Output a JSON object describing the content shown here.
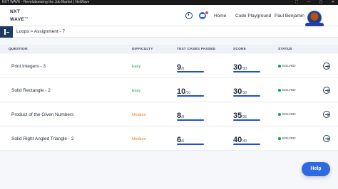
{
  "window": {
    "title": "NXT WAVE - Revolutionizing the Job Market | NxtWave",
    "controls": [
      "⛶",
      "—",
      "▢",
      "✕"
    ]
  },
  "header": {
    "logo_line1": "NXT",
    "logo_line2": "WAVE",
    "logo_tm": "TM",
    "notification_icon": "chat-icon",
    "nav": [
      {
        "label": "Home"
      },
      {
        "label": "Code Playground"
      }
    ],
    "user_name": "Paul Benjamin"
  },
  "breadcrumb": {
    "text": "Loops > Assignment - 7"
  },
  "table": {
    "columns": [
      "QUESTION",
      "DIFFICULTY",
      "TEST CASES PASSED",
      "SCORE",
      "STATUS"
    ],
    "rows": [
      {
        "question": "Print Integers - 3",
        "difficulty": "Easy",
        "passed": "9",
        "total_cases": "/9",
        "score": "30",
        "max_score": "/30",
        "status": "SOLVED"
      },
      {
        "question": "Solid Rectangle - 2",
        "difficulty": "Easy",
        "passed": "10",
        "total_cases": "/10",
        "score": "30",
        "max_score": "/30",
        "status": "SOLVED"
      },
      {
        "question": "Product of the Given Numbers",
        "difficulty": "Medium",
        "passed": "8",
        "total_cases": "/8",
        "score": "35",
        "max_score": "/35",
        "status": "SOLVED"
      },
      {
        "question": "Solid Right Angled Triangle - 2",
        "difficulty": "Medium",
        "passed": "6",
        "total_cases": "/6",
        "score": "40",
        "max_score": "/40",
        "status": "SOLVED"
      }
    ]
  },
  "colors": {
    "easy": "#16a34a",
    "medium": "#ea7a1a",
    "accent": "#1d4ed8"
  },
  "help_label": "Help"
}
